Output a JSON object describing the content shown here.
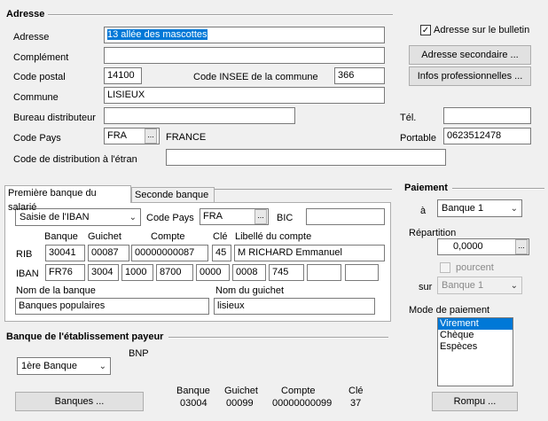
{
  "section_adresse": "Adresse",
  "chk_bulletin": "Adresse sur le bulletin",
  "labels": {
    "adresse": "Adresse",
    "complement": "Complément",
    "code_postal": "Code postal",
    "code_insee": "Code INSEE de la commune",
    "commune": "Commune",
    "bureau": "Bureau distributeur",
    "code_pays": "Code Pays",
    "code_distrib": "Code de distribution à l'étran",
    "tel": "Tél.",
    "portable": "Portable"
  },
  "values": {
    "adresse": "13 allée des mascottes",
    "complement": "",
    "code_postal": "14100",
    "code_insee": "366",
    "commune": "LISIEUX",
    "bureau": "",
    "code_pays": "FRA",
    "pays_name": "FRANCE",
    "code_distrib": "",
    "tel": "",
    "portable": "0623512478"
  },
  "buttons": {
    "adresse_secondaire": "Adresse secondaire ...",
    "infos_pro": "Infos professionnelles ...",
    "banques": "Banques ...",
    "rompu": "Rompu ...",
    "ellipsis": "..."
  },
  "tabs": [
    "Première banque du salarié",
    "Seconde banque"
  ],
  "bank": {
    "mode": "Saisie de l'IBAN",
    "code_pays_label": "Code Pays",
    "code_pays": "FRA",
    "bic_label": "BIC",
    "bic": "",
    "hdr_banque": "Banque",
    "hdr_guichet": "Guichet",
    "hdr_compte": "Compte",
    "hdr_cle": "Clé",
    "hdr_libelle": "Libellé du compte",
    "rib_label": "RIB",
    "rib": [
      "30041",
      "00087",
      "00000000087",
      "45",
      "M RICHARD Emmanuel"
    ],
    "iban_label": "IBAN",
    "iban": [
      "FR76",
      "3004",
      "1000",
      "8700",
      "0000",
      "0008",
      "745",
      "",
      ""
    ],
    "nom_banque_label": "Nom de la banque",
    "nom_guichet_label": "Nom du guichet",
    "nom_banque": "Banques populaires",
    "nom_guichet": "lisieux"
  },
  "payeur": {
    "section": "Banque de l'établissement payeur",
    "select": "1ère Banque",
    "bank_name": "BNP",
    "hdr_banque": "Banque",
    "hdr_guichet": "Guichet",
    "hdr_compte": "Compte",
    "hdr_cle": "Clé",
    "banque": "03004",
    "guichet": "00099",
    "compte": "00000000099",
    "cle": "37"
  },
  "paiement": {
    "section": "Paiement",
    "a_label": "à",
    "a_value": "Banque 1",
    "repartition_label": "Répartition",
    "repartition": "0,0000",
    "pourcent": "pourcent",
    "sur_label": "sur",
    "sur_value": "Banque 1",
    "mode_label": "Mode de paiement",
    "modes": [
      "Virement",
      "Chèque",
      "Espèces"
    ]
  }
}
